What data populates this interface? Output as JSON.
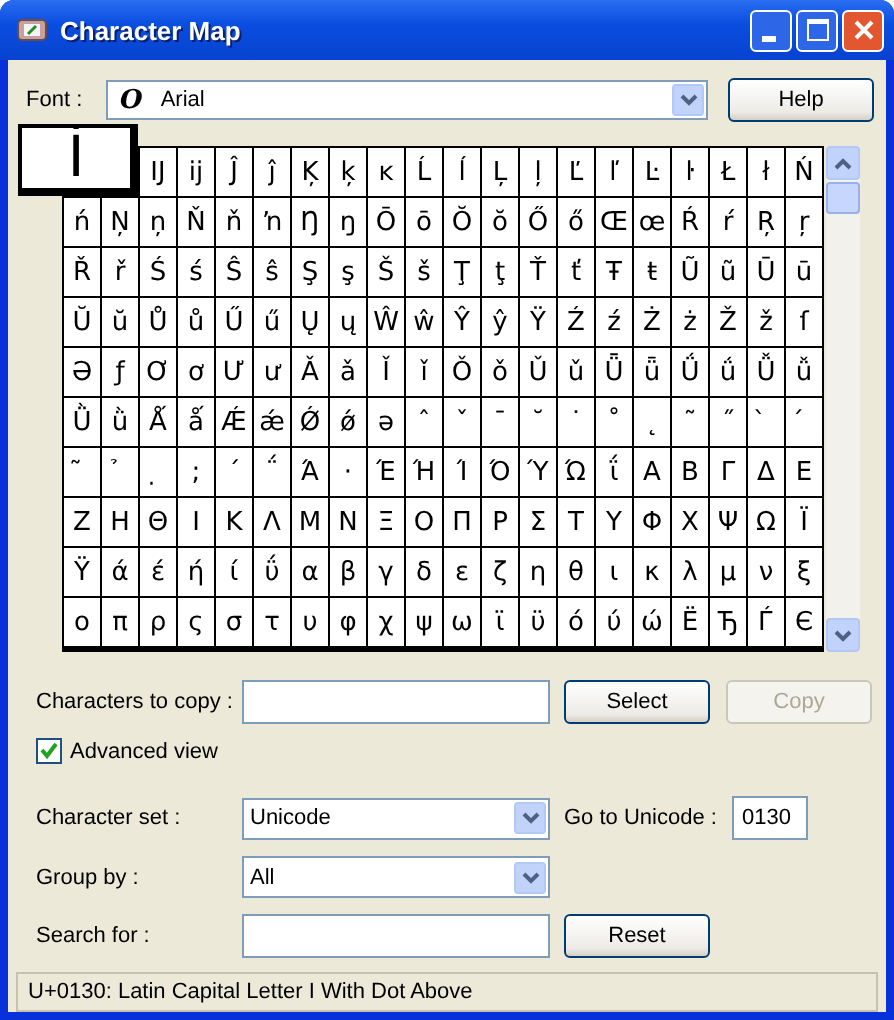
{
  "window": {
    "title": "Character Map"
  },
  "font": {
    "label": "Font :",
    "value": "Arial",
    "icon_glyph": "O"
  },
  "help_button": "Help",
  "magnifier": {
    "char": "İ"
  },
  "grid": {
    "rows": [
      [
        "",
        "",
        "Ĳ",
        "ĳ",
        "Ĵ",
        "ĵ",
        "Ķ",
        "ķ",
        "ĸ",
        "Ĺ",
        "ĺ",
        "Ļ",
        "ļ",
        "Ľ",
        "ľ",
        "Ŀ",
        "ŀ",
        "Ł",
        "ł",
        "Ń"
      ],
      [
        "ń",
        "Ņ",
        "ņ",
        "Ň",
        "ň",
        "ŉ",
        "Ŋ",
        "ŋ",
        "Ō",
        "ō",
        "Ŏ",
        "ŏ",
        "Ő",
        "ő",
        "Œ",
        "œ",
        "Ŕ",
        "ŕ",
        "Ŗ",
        "ŗ"
      ],
      [
        "Ř",
        "ř",
        "Ś",
        "ś",
        "Ŝ",
        "ŝ",
        "Ş",
        "ş",
        "Š",
        "š",
        "Ţ",
        "ţ",
        "Ť",
        "ť",
        "Ŧ",
        "ŧ",
        "Ũ",
        "ũ",
        "Ū",
        "ū"
      ],
      [
        "Ŭ",
        "ŭ",
        "Ů",
        "ů",
        "Ű",
        "ű",
        "Ų",
        "ų",
        "Ŵ",
        "ŵ",
        "Ŷ",
        "ŷ",
        "Ÿ",
        "Ź",
        "ź",
        "Ż",
        "ż",
        "Ž",
        "ž",
        "ſ"
      ],
      [
        "Ə",
        "ƒ",
        "Ơ",
        "ơ",
        "Ư",
        "ư",
        "Ǎ",
        "ǎ",
        "Ǐ",
        "ǐ",
        "Ǒ",
        "ǒ",
        "Ǔ",
        "ǔ",
        "Ǖ",
        "ǖ",
        "Ǘ",
        "ǘ",
        "Ǚ",
        "ǚ"
      ],
      [
        "Ǜ",
        "ǜ",
        "Ǻ",
        "ǻ",
        "Ǽ",
        "ǽ",
        "Ǿ",
        "ǿ",
        "ə",
        "ˆ",
        "ˇ",
        "ˉ",
        "˘",
        "˙",
        "˚",
        "˛",
        "˜",
        "˝",
        "̀",
        "́"
      ],
      [
        "̃",
        "̉",
        "̣",
        ";",
        "΄",
        "΅",
        "Ά",
        "·",
        "Έ",
        "Ή",
        "Ί",
        "Ό",
        "Ύ",
        "Ώ",
        "ΐ",
        "Α",
        "Β",
        "Γ",
        "Δ",
        "Ε"
      ],
      [
        "Ζ",
        "Η",
        "Θ",
        "Ι",
        "Κ",
        "Λ",
        "Μ",
        "Ν",
        "Ξ",
        "Ο",
        "Π",
        "Ρ",
        "Σ",
        "Τ",
        "Υ",
        "Φ",
        "Χ",
        "Ψ",
        "Ω",
        "Ϊ"
      ],
      [
        "Ϋ",
        "ά",
        "έ",
        "ή",
        "ί",
        "ΰ",
        "α",
        "β",
        "γ",
        "δ",
        "ε",
        "ζ",
        "η",
        "θ",
        "ι",
        "κ",
        "λ",
        "μ",
        "ν",
        "ξ"
      ],
      [
        "ο",
        "π",
        "ρ",
        "ς",
        "σ",
        "τ",
        "υ",
        "φ",
        "χ",
        "ψ",
        "ω",
        "ϊ",
        "ϋ",
        "ό",
        "ύ",
        "ώ",
        "Ё",
        "Ђ",
        "Ѓ",
        "Є"
      ]
    ]
  },
  "copy": {
    "label": "Characters to copy :",
    "select_button": "Select",
    "copy_button": {
      "label": "Copy",
      "disabled": true
    }
  },
  "advanced_view": {
    "label": "Advanced view",
    "checked": true
  },
  "character_set": {
    "label": "Character set :",
    "value": "Unicode"
  },
  "goto_unicode": {
    "label": "Go to Unicode :",
    "value": "0130"
  },
  "group_by": {
    "label": "Group by :",
    "value": "All"
  },
  "search": {
    "label": "Search for :",
    "reset_button": "Reset"
  },
  "status_bar": "U+0130: Latin Capital Letter I With Dot Above"
}
